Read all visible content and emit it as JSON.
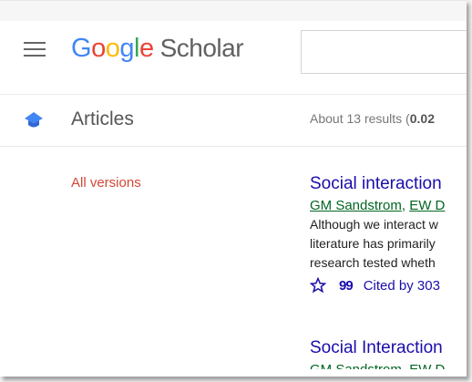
{
  "header": {
    "menu_icon": "hamburger-menu-icon",
    "logo": {
      "G": "G",
      "o1": "o",
      "o2": "o",
      "g": "g",
      "l": "l",
      "e": "e",
      "scholar": "Scholar"
    },
    "logo_colors": {
      "blue": "#4285f4",
      "red": "#ea4335",
      "yellow": "#fbbc05",
      "green": "#34a853"
    },
    "search": {
      "value": "",
      "placeholder": ""
    }
  },
  "subheader": {
    "icon": "graduation-cap-icon",
    "title": "Articles",
    "results_prefix": "About 13 results (",
    "results_time": "0.02"
  },
  "sidebar": {
    "all_versions": "All versions"
  },
  "results": [
    {
      "title": "Social interaction",
      "authors": [
        "GM Sandstrom",
        "EW D"
      ],
      "snippet": [
        "Although we interact w",
        "literature has primarily",
        "research tested wheth"
      ],
      "actions": {
        "star_icon": "star-outline-icon",
        "cite_icon": "quote-icon",
        "cite_symbol": "99",
        "cited_by": "Cited by 303"
      }
    },
    {
      "title": "Social Interaction",
      "authors": [
        "GM Sandstrom",
        "EW D"
      ]
    }
  ]
}
